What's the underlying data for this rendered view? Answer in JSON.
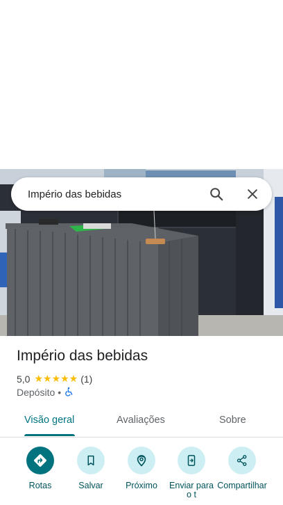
{
  "search": {
    "query": "Império das bebidas"
  },
  "place": {
    "name": "Império das bebidas",
    "rating": "5,0",
    "stars": "★★★★★",
    "review_count": "(1)",
    "category": "Depósito",
    "separator": "•"
  },
  "tabs": [
    {
      "label": "Visão geral",
      "active": true
    },
    {
      "label": "Avaliações",
      "active": false
    },
    {
      "label": "Sobre",
      "active": false
    }
  ],
  "actions": [
    {
      "label": "Rotas",
      "icon": "directions-icon"
    },
    {
      "label": "Salvar",
      "icon": "bookmark-icon"
    },
    {
      "label": "Próximo",
      "icon": "nearby-icon"
    },
    {
      "label": "Enviar para o t",
      "icon": "send-to-phone-icon"
    },
    {
      "label": "Compartilhar",
      "icon": "share-icon"
    }
  ],
  "colors": {
    "accent": "#00737e",
    "action_circle": "#cdeff4",
    "star": "#fbbc04",
    "accessibility": "#1a73e8"
  }
}
